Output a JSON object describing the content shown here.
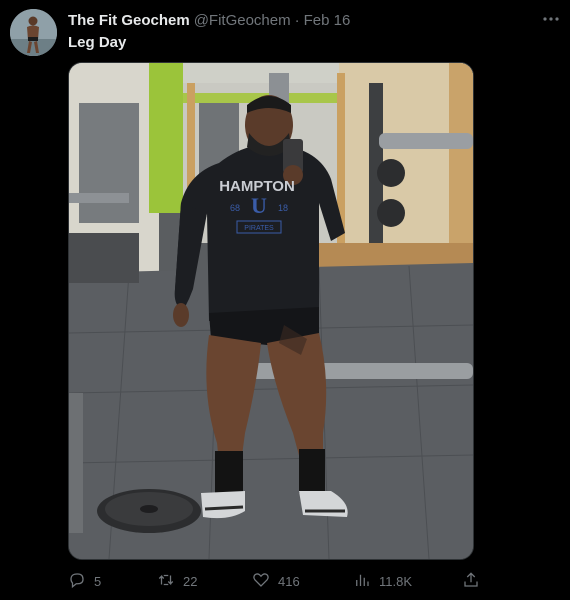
{
  "tweet": {
    "author_name": "The Fit Geochem",
    "handle": "@FitGeochem",
    "separator": "·",
    "date": "Feb 16",
    "text": "Leg Day"
  },
  "hoodie": {
    "text": "HAMPTON",
    "letter": "U",
    "year_left": "68",
    "year_right": "18",
    "badge": "PIRATES"
  },
  "actions": {
    "replies": "5",
    "retweets": "22",
    "likes": "416",
    "views": "11.8K"
  },
  "icons": {
    "more": "more-horizontal-icon",
    "reply": "reply-icon",
    "retweet": "retweet-icon",
    "like": "heart-icon",
    "views": "views-chart-icon",
    "share": "share-icon"
  },
  "colors": {
    "background": "#000000",
    "text_primary": "#e7e9ea",
    "text_secondary": "#71767b",
    "border": "#2f3336"
  }
}
